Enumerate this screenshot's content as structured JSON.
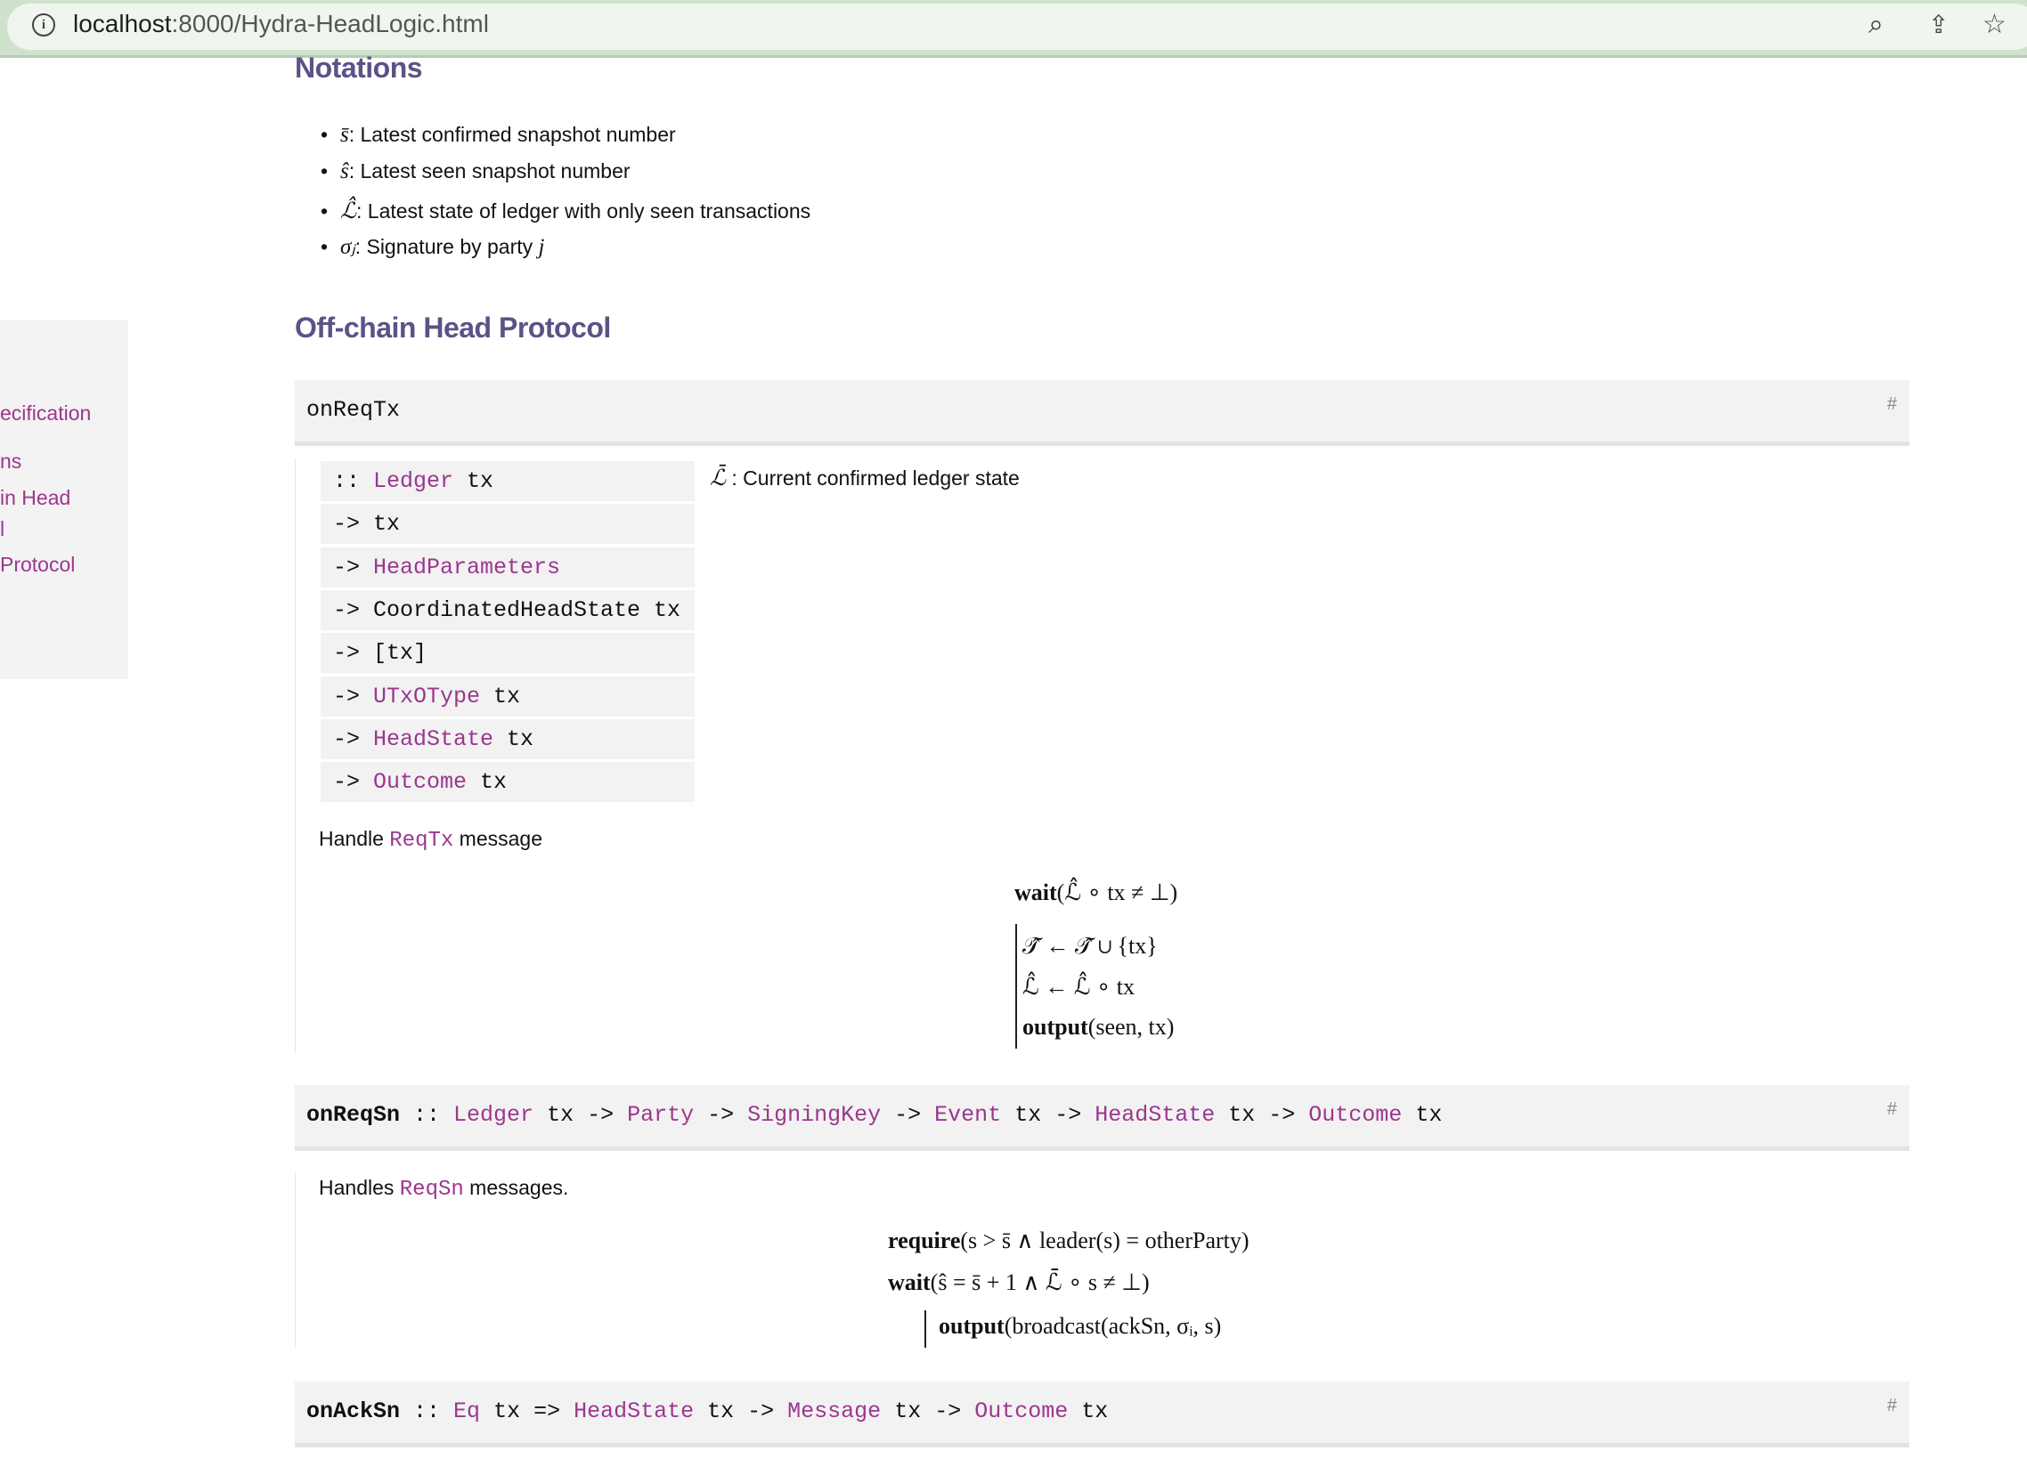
{
  "browser": {
    "url_host": "localhost",
    "url_path": ":8000/Hydra-HeadLogic.html",
    "icons": [
      "info-icon",
      "zoom-icon",
      "share-icon",
      "bookmark-star-icon"
    ]
  },
  "sidebar": {
    "items": [
      {
        "label": "ecification"
      },
      {
        "label": "ns"
      },
      {
        "label": "in Head"
      },
      {
        "label": "l"
      },
      {
        "label": "Protocol"
      }
    ]
  },
  "notations": {
    "title": "Notations",
    "items": [
      {
        "symbol": "s̄",
        "text": ": Latest confirmed snapshot number"
      },
      {
        "symbol": "ŝ",
        "text": ": Latest seen snapshot number"
      },
      {
        "symbol": "ℒ̂",
        "text": ": Latest state of ledger with only seen transactions"
      },
      {
        "symbol": "σⱼ",
        "text": ": Signature by party ",
        "tail": "j"
      }
    ]
  },
  "section": {
    "title": "Off-chain Head Protocol"
  },
  "onReqTx": {
    "name": "onReqTx",
    "anchor": "#",
    "signature": [
      [
        {
          "t": ":: "
        },
        {
          "t": "Ledger",
          "ty": true
        },
        {
          "t": " tx"
        }
      ],
      [
        {
          "t": "-> tx"
        }
      ],
      [
        {
          "t": "-> "
        },
        {
          "t": "HeadParameters",
          "ty": true
        }
      ],
      [
        {
          "t": "-> CoordinatedHeadState tx"
        }
      ],
      [
        {
          "t": "-> [tx]"
        }
      ],
      [
        {
          "t": "-> "
        },
        {
          "t": "UTxOType",
          "ty": true
        },
        {
          "t": " tx"
        }
      ],
      [
        {
          "t": "-> "
        },
        {
          "t": "HeadState",
          "ty": true
        },
        {
          "t": " tx"
        }
      ],
      [
        {
          "t": "-> "
        },
        {
          "t": "Outcome",
          "ty": true
        },
        {
          "t": " tx"
        }
      ]
    ],
    "arg_note_symbol": "ℒ̄",
    "arg_note": " : Current confirmed ledger state",
    "doc_pre": "Handle ",
    "doc_link": "ReqTx",
    "doc_post": " message",
    "math": [
      {
        "kw": "wait",
        "rest": "(ℒ̂ ∘ tx ≠ ⊥)"
      },
      {
        "kw": "",
        "rest": "𝒯̂ ← 𝒯̂ ∪ {tx}"
      },
      {
        "kw": "",
        "rest": "ℒ̂ ← ℒ̂ ∘ tx"
      },
      {
        "kw": "output",
        "rest": "(seen, tx)"
      }
    ]
  },
  "onReqSn": {
    "anchor": "#",
    "code": [
      {
        "t": "onReqSn",
        "kw": true
      },
      {
        "t": " :: "
      },
      {
        "t": "Ledger",
        "ty": true
      },
      {
        "t": " tx -> "
      },
      {
        "t": "Party",
        "ty": true
      },
      {
        "t": " -> "
      },
      {
        "t": "SigningKey",
        "ty": true
      },
      {
        "t": " -> "
      },
      {
        "t": "Event",
        "ty": true
      },
      {
        "t": " tx -> "
      },
      {
        "t": "HeadState",
        "ty": true
      },
      {
        "t": " tx -> "
      },
      {
        "t": "Outcome",
        "ty": true
      },
      {
        "t": " tx"
      }
    ],
    "doc_pre": "Handles ",
    "doc_link": "ReqSn",
    "doc_post": " messages.",
    "math": [
      {
        "kw": "require",
        "rest": "(s > s̄ ∧ leader(s) = otherParty)"
      },
      {
        "kw": "wait",
        "rest": "(ŝ = s̄ + 1 ∧ ℒ̄ ∘ s ≠ ⊥)"
      },
      {
        "kw": "output",
        "rest": "(broadcast(ackSn, σᵢ, s)"
      }
    ]
  },
  "onAckSn": {
    "anchor": "#",
    "code": [
      {
        "t": "onAckSn",
        "kw": true
      },
      {
        "t": " :: "
      },
      {
        "t": "Eq",
        "ty": true
      },
      {
        "t": " tx => "
      },
      {
        "t": "HeadState",
        "ty": true
      },
      {
        "t": " tx -> "
      },
      {
        "t": "Message",
        "ty": true
      },
      {
        "t": " tx -> "
      },
      {
        "t": "Outcome",
        "ty": true
      },
      {
        "t": " tx"
      }
    ]
  },
  "colors": {
    "link": "#9c368f",
    "heading": "#5b5287",
    "code_bg": "#f2f2f2"
  }
}
